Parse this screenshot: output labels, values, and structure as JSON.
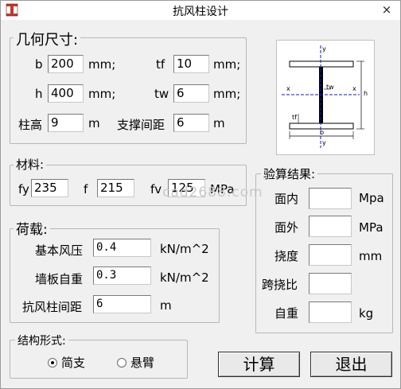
{
  "window": {
    "title": "抗风柱设计",
    "close_glyph": "×"
  },
  "section_size": {
    "legend": "几何尺寸:",
    "b": {
      "label": "b",
      "value": "200",
      "unit": "mm;"
    },
    "tf": {
      "label": "tf",
      "value": "10",
      "unit": "mm;"
    },
    "h": {
      "label": "h",
      "value": "400",
      "unit": "mm;"
    },
    "tw": {
      "label": "tw",
      "value": "6",
      "unit": "mm;"
    },
    "column_height": {
      "label": "柱高",
      "value": "9",
      "unit": "m"
    },
    "brace_spacing": {
      "label": "支撑间距",
      "value": "6",
      "unit": "m"
    }
  },
  "diagram": {
    "labels": {
      "y_top": "y",
      "y_bottom": "y",
      "x_left": "x",
      "x_right": "x",
      "tw": "tw",
      "tf": "tf",
      "h": "h",
      "b": "b"
    }
  },
  "section_material": {
    "legend": "材料:",
    "fy": {
      "label": "fy",
      "value": "235"
    },
    "f": {
      "label": "f",
      "value": "215"
    },
    "fv": {
      "label": "fv",
      "value": "125"
    },
    "unit": "MPa"
  },
  "section_load": {
    "legend": "荷载:",
    "wind_pressure": {
      "label": "基本风压",
      "value": "0.4",
      "unit": "kN/m^2"
    },
    "wall_weight": {
      "label": "墙板自重",
      "value": "0.3",
      "unit": "kN/m^2"
    },
    "column_spacing": {
      "label": "抗风柱间距",
      "value": "6",
      "unit": "m"
    }
  },
  "section_results": {
    "legend": "验算结果:",
    "in_plane": {
      "label": "面内",
      "value": "",
      "unit": "Mpa"
    },
    "out_plane": {
      "label": "面外",
      "value": "",
      "unit": "MPa"
    },
    "deflection": {
      "label": "挠度",
      "value": "",
      "unit": "mm"
    },
    "span_ratio": {
      "label": "跨挠比",
      "value": ""
    },
    "self_weight": {
      "label": "自重",
      "value": "",
      "unit": "kg"
    }
  },
  "section_structure": {
    "legend": "结构形式:",
    "options": [
      {
        "label": "简支",
        "selected": true
      },
      {
        "label": "悬臂",
        "selected": false
      }
    ]
  },
  "buttons": {
    "calculate": "计算",
    "exit": "退出"
  },
  "watermark": "cad2688.com"
}
